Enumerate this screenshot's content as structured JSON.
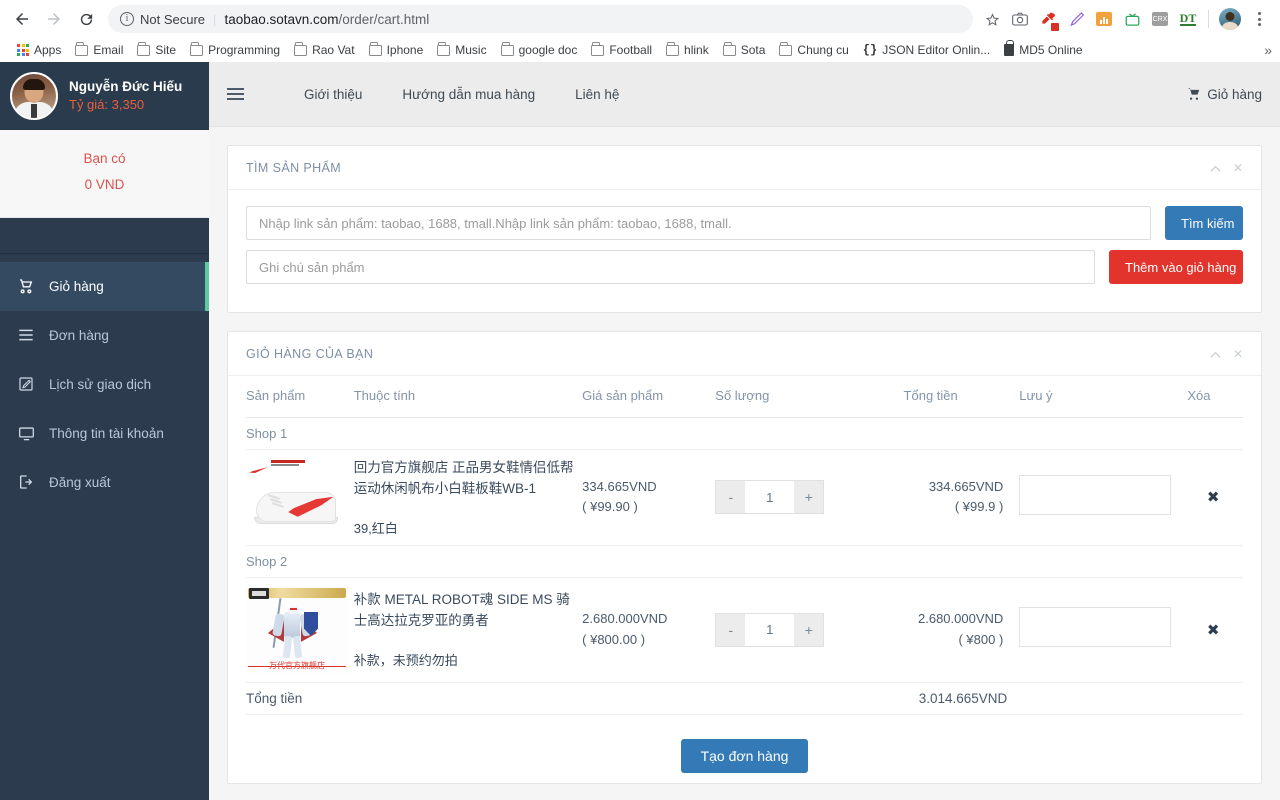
{
  "browser": {
    "security_label": "Not Secure",
    "url_host": "taobao.sotavn.com",
    "url_path": "/order/cart.html",
    "bookmarks": [
      {
        "label": "Apps",
        "icon": "apps-grid-icon"
      },
      {
        "label": "Email",
        "icon": "folder-icon"
      },
      {
        "label": "Site",
        "icon": "folder-icon"
      },
      {
        "label": "Programming",
        "icon": "folder-icon"
      },
      {
        "label": "Rao Vat",
        "icon": "folder-icon"
      },
      {
        "label": "Iphone",
        "icon": "folder-icon"
      },
      {
        "label": "Music",
        "icon": "folder-icon"
      },
      {
        "label": "google doc",
        "icon": "folder-icon"
      },
      {
        "label": "Football",
        "icon": "folder-icon"
      },
      {
        "label": "hlink",
        "icon": "folder-icon"
      },
      {
        "label": "Sota",
        "icon": "folder-icon"
      },
      {
        "label": "Chung cu",
        "icon": "folder-icon"
      },
      {
        "label": "JSON Editor Onlin...",
        "icon": "json-icon"
      },
      {
        "label": "MD5 Online",
        "icon": "lock-icon"
      }
    ],
    "bookmark_overflow": "»",
    "extensions": [
      "camera-icon",
      "eyedropper-icon",
      "pen-icon",
      "chart-icon",
      "tv-icon",
      "crx-icon",
      "dt-icon"
    ]
  },
  "sidebar": {
    "user_name": "Nguyễn Đức Hiếu",
    "user_rate": "Tỷ giá: 3,350",
    "balance_label": "Bạn có",
    "balance_value": "0 VND",
    "items": [
      {
        "label": "Giỏ hàng",
        "icon": "cart-icon",
        "active": true
      },
      {
        "label": "Đơn hàng",
        "icon": "list-icon",
        "active": false
      },
      {
        "label": "Lịch sử giao dịch",
        "icon": "edit-icon",
        "active": false
      },
      {
        "label": "Thông tin tài khoản",
        "icon": "monitor-icon",
        "active": false
      },
      {
        "label": "Đăng xuất",
        "icon": "logout-icon",
        "active": false
      }
    ]
  },
  "topnav": {
    "menu_icon": "hamburger-icon",
    "links": [
      "Giới thiệu",
      "Hướng dẫn mua hàng",
      "Liên hệ"
    ],
    "cart_label": "Giỏ hàng"
  },
  "search_panel": {
    "title": "TÌM SẢN PHẨM",
    "collapse_icon": "chevron-up-icon",
    "close_icon": "close-icon",
    "link_placeholder": "Nhập link sản phẩm: taobao, 1688, tmall.Nhập link sản phẩm: taobao, 1688, tmall.",
    "link_value": "",
    "note_placeholder": "Ghi chú sản phẩm",
    "note_value": "",
    "search_button": "Tìm kiếm",
    "add_button": "Thêm vào giỏ hàng"
  },
  "cart_panel": {
    "title": "GIỎ HÀNG CỦA BẠN",
    "collapse_icon": "chevron-up-icon",
    "close_icon": "close-icon",
    "columns": [
      "Sản phẩm",
      "Thuộc tính",
      "Giá sản phẩm",
      "Số lượng",
      "Tổng tiền",
      "Lưu ý",
      "Xóa"
    ],
    "groups": [
      {
        "shop": "Shop 1",
        "items": [
          {
            "image": "sneaker-thumbnail",
            "title": "回力官方旗舰店 正品男女鞋情侣低帮运动休闲帆布小白鞋板鞋WB-1",
            "attribute": "39,红白",
            "price_vnd": "334.665VND",
            "price_cny": "( ¥99.90 )",
            "qty": "1",
            "minus": "-",
            "plus": "+",
            "total_vnd": "334.665VND",
            "total_cny": "( ¥99.9 )",
            "note": "",
            "delete_icon": "close-icon"
          }
        ]
      },
      {
        "shop": "Shop 2",
        "items": [
          {
            "image": "gundam-thumbnail",
            "title": "补款 METAL ROBOT魂 SIDE MS 骑士高达拉克罗亚的勇者",
            "attribute": "补款，未预约勿拍",
            "price_vnd": "2.680.000VND",
            "price_cny": "( ¥800.00 )",
            "qty": "1",
            "minus": "-",
            "plus": "+",
            "total_vnd": "2.680.000VND",
            "total_cny": "( ¥800 )",
            "note": "",
            "delete_icon": "close-icon"
          }
        ]
      }
    ],
    "grand_total_label": "Tổng tiền",
    "grand_total_value": "3.014.665VND",
    "submit_button": "Tạo đơn hàng"
  },
  "colors": {
    "sidebar_bg": "#2c3b4e",
    "sidebar_active": "#344a61",
    "accent_green": "#5fc8a0",
    "primary_blue": "#337ab7",
    "danger_red": "#e2342c",
    "rate_orange": "#e8603c"
  }
}
